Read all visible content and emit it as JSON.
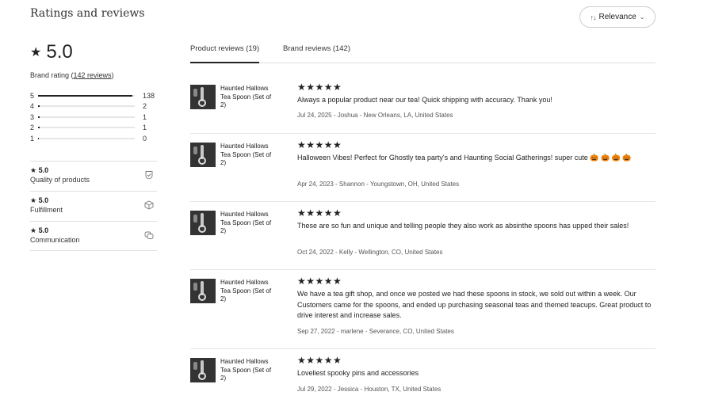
{
  "heading": "Ratings and reviews",
  "sort": {
    "icon": "sort-arrows-icon",
    "label": "Relevance",
    "chevron": "⌄"
  },
  "rating": {
    "value": "5.0",
    "brand_rating_label": "Brand rating (",
    "reviews_link": "142 reviews",
    "close_paren": ")"
  },
  "distribution": [
    {
      "stars": "5",
      "count": "138",
      "fraction": 0.972
    },
    {
      "stars": "4",
      "count": "2",
      "fraction": 0.014
    },
    {
      "stars": "3",
      "count": "1",
      "fraction": 0.007
    },
    {
      "stars": "2",
      "count": "1",
      "fraction": 0.007
    },
    {
      "stars": "1",
      "count": "0",
      "fraction": 0.0
    }
  ],
  "sub_ratings": [
    {
      "value": "5.0",
      "label": "Quality of products",
      "icon": "shield-check-icon"
    },
    {
      "value": "5.0",
      "label": "Fulfillment",
      "icon": "box-icon"
    },
    {
      "value": "5.0",
      "label": "Communication",
      "icon": "chat-icon"
    }
  ],
  "tabs": [
    {
      "label": "Product reviews (19)",
      "active": true
    },
    {
      "label": "Brand reviews (142)",
      "active": false
    }
  ],
  "reviews": [
    {
      "product": "Haunted Hallows Tea Spoon (Set of 2)",
      "stars": "★★★★★",
      "text": "Always a popular product near our tea! Quick shipping with accuracy. Thank you!",
      "meta": "Jul 24, 2025 - Joshua - New Orleans, LA, United States"
    },
    {
      "product": "Haunted Hallows Tea Spoon (Set of 2)",
      "stars": "★★★★★",
      "text": "Halloween Vibes! Perfect for Ghostly tea party's and Haunting Social Gatherings! super cute 🎃 🎃 🎃 🎃",
      "meta": "Apr 24, 2023 - Shannon - Youngstown, OH, United States"
    },
    {
      "product": "Haunted Hallows Tea Spoon (Set of 2)",
      "stars": "★★★★★",
      "text": "These are so fun and unique and telling people they also work as absinthe spoons has upped their sales!",
      "meta": "Oct 24, 2022 - Kelly - Wellington, CO, United States"
    },
    {
      "product": "Haunted Hallows Tea Spoon (Set of 2)",
      "stars": "★★★★★",
      "text": "We have a tea gift shop, and once we posted we had these spoons in stock, we sold out within a week. Our Customers came for the spoons, and ended up purchasing seasonal teas and themed teacups. Great product to drive interest and increase sales.",
      "meta": "Sep 27, 2022 - marlene - Severance, CO, United States"
    },
    {
      "product": "Haunted Hallows Tea Spoon (Set of 2)",
      "stars": "★★★★★",
      "text": "Loveliest spooky pins and accessories",
      "meta": "Jul 29, 2022 - Jessica - Houston, TX, United States"
    }
  ]
}
